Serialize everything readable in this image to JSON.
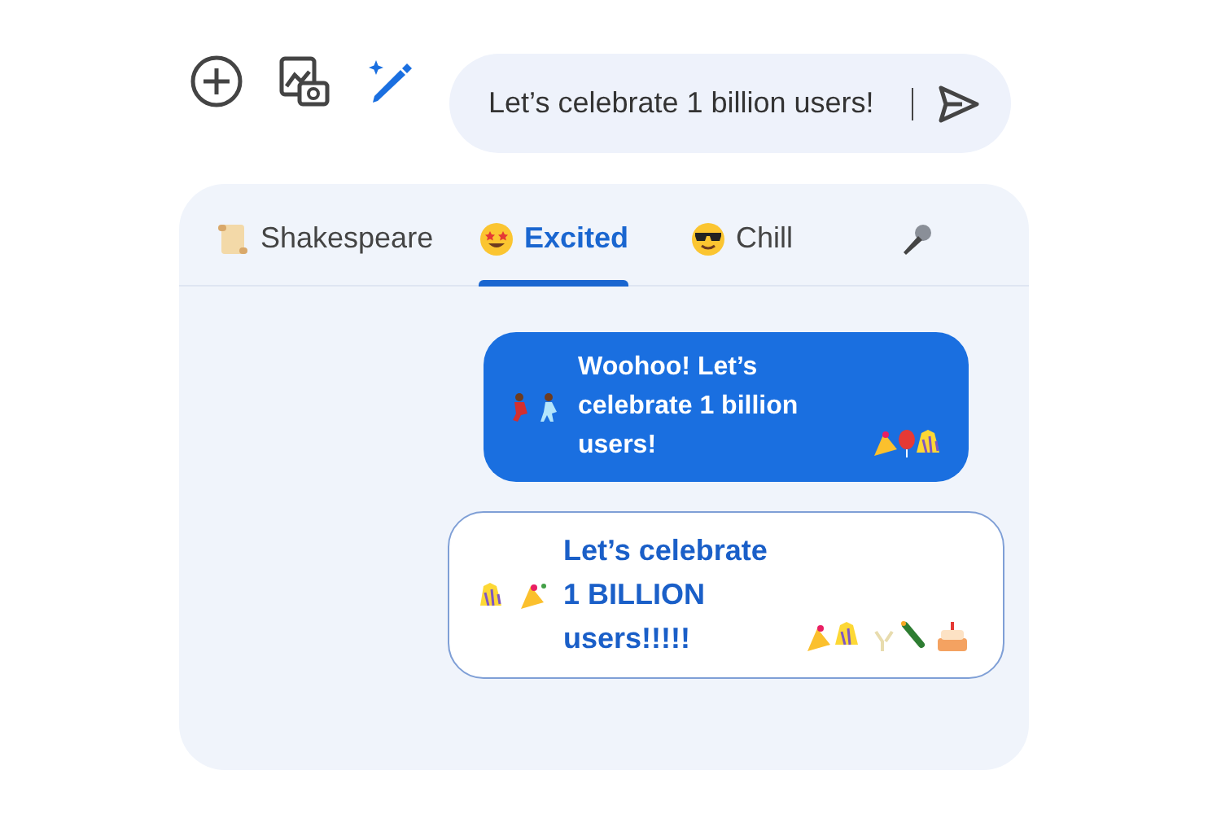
{
  "composer": {
    "value": "Let’s celebrate 1 billion users!"
  },
  "tabs": [
    {
      "label": "Shakespeare",
      "selected": false,
      "kind": "scroll"
    },
    {
      "label": "Excited",
      "selected": true,
      "kind": "starstruck"
    },
    {
      "label": "Chill",
      "selected": false,
      "kind": "sunglasses"
    },
    {
      "kind": "microphone",
      "selected": false
    }
  ],
  "messages": [
    {
      "kind": "original",
      "text": "Woohoo! Let’s celebrate 1 billion users!"
    },
    {
      "kind": "suggestion",
      "text": "Let’s celebrate 1 BILLION users!!!!!"
    }
  ]
}
